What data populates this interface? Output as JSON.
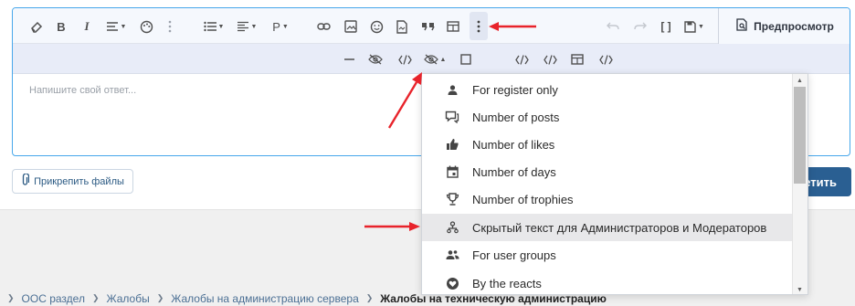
{
  "editor": {
    "placeholder": "Напишите свой ответ...",
    "toolbar": {
      "icons": [
        "eraser-icon",
        "bold-icon",
        "italic-icon",
        "text-align-icon",
        "palette-icon",
        "more-dots-icon",
        "list-icon",
        "align-icon",
        "paragraph-icon",
        "link-icon",
        "image-icon",
        "smile-icon",
        "file-icon",
        "quote-icon",
        "table-icon",
        "more-vertical-icon",
        "undo-icon",
        "redo-icon",
        "brackets-icon",
        "save-icon"
      ],
      "bold_label": "B",
      "italic_label": "I",
      "paragraph_label": "P",
      "brackets_label": "[ ]",
      "preview_label": "Предпросмотр"
    }
  },
  "attach_label": "Прикрепить файлы",
  "reply_label": "етить",
  "dropdown": {
    "items": [
      {
        "icon": "user-icon",
        "label": "For register only"
      },
      {
        "icon": "comment-icon",
        "label": "Number of posts"
      },
      {
        "icon": "thumbs-up-icon",
        "label": "Number of likes"
      },
      {
        "icon": "calendar-icon",
        "label": "Number of days"
      },
      {
        "icon": "trophy-icon",
        "label": "Number of trophies"
      },
      {
        "icon": "moderator-icon",
        "label": "Скрытый текст для Администраторов и Модераторов",
        "selected": true
      },
      {
        "icon": "users-icon",
        "label": "For user groups"
      },
      {
        "icon": "heart-icon",
        "label": "By the reacts"
      }
    ]
  },
  "breadcrumb": {
    "items": [
      "ООС раздел",
      "Жалобы",
      "Жалобы на администрацию сервера"
    ],
    "current": "Жалобы на техническую администрацию"
  },
  "colors": {
    "accent": "#47a7eb",
    "button": "#2a5f92",
    "arrow": "#e8232b"
  }
}
